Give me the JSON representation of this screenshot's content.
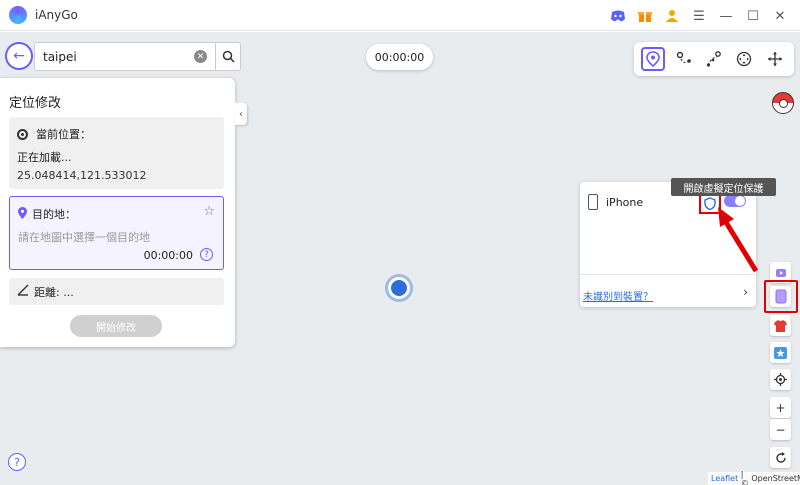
{
  "app": {
    "title": "iAnyGo"
  },
  "titlebar": {
    "icons": [
      "discord-icon",
      "gift-icon",
      "user-icon",
      "menu-icon",
      "minimize-icon",
      "maximize-icon",
      "close-icon"
    ]
  },
  "search": {
    "value": "taipei"
  },
  "timer": {
    "value": "00:00:00"
  },
  "mode_bar": {
    "modes": [
      "teleport-mode",
      "two-spot-mode",
      "multi-spot-mode",
      "joystick-mode",
      "jump-teleport-mode"
    ],
    "active": "teleport-mode"
  },
  "left_panel": {
    "title": "定位修改",
    "current": {
      "label": "當前位置：",
      "status": "正在加載...",
      "coords": "25.048414,121.533012"
    },
    "destination": {
      "label": "目的地：",
      "placeholder": "請在地圖中選擇一個目的地",
      "time": "00:00:00"
    },
    "distance": {
      "label": "距離: ..."
    },
    "start_button": "開始修改"
  },
  "device_panel": {
    "device_name": "iPhone",
    "toggle_on": true,
    "unrecognized_link": "未識別到裝置？"
  },
  "tooltip": {
    "text": "開啟虛擬定位保護"
  },
  "attribution": {
    "leaflet": "Leaflet",
    "osm": "OpenStreetMap"
  },
  "colors": {
    "accent": "#6a5cff",
    "highlight": "#e00000",
    "link": "#2b6de1"
  }
}
